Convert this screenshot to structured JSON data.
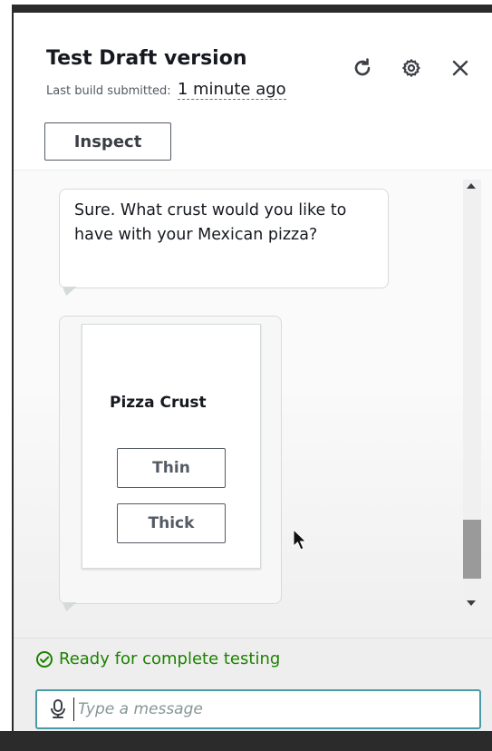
{
  "header": {
    "title": "Test Draft version",
    "subtitle_prefix": "Last build submitted:",
    "subtitle_time": "1 minute ago",
    "inspect_label": "Inspect",
    "icons": [
      "refresh-icon",
      "gear-icon",
      "close-icon"
    ]
  },
  "chat": {
    "bot_message": "Sure. What crust would you like to have with your Mexican pizza?",
    "card": {
      "title": "Pizza Crust",
      "options": [
        "Thin",
        "Thick"
      ]
    }
  },
  "footer": {
    "status": "Ready for complete testing",
    "input_placeholder": "Type a message"
  },
  "colors": {
    "status_green": "#1d8102",
    "input_border": "#4d9aa7",
    "button_border": "#545b64"
  }
}
